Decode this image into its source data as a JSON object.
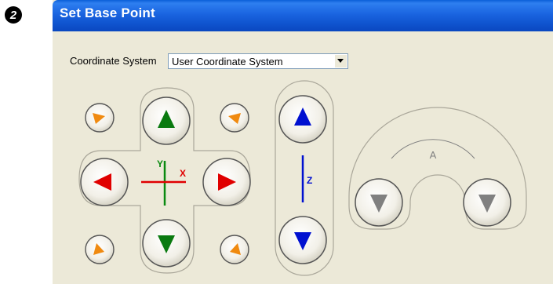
{
  "step_number": "2",
  "dialog": {
    "title": "Set Base Point",
    "coordinate_system": {
      "label": "Coordinate System",
      "selected": "User Coordinate System"
    }
  },
  "jog_pad": {
    "axis_x": "X",
    "axis_y": "Y",
    "axis_z": "Z",
    "axis_a": "A"
  },
  "colors": {
    "title_bar": "#0a5fd8",
    "window_bg": "#ece9d8",
    "x_axis": "#e00000",
    "y_axis": "#0a8a10",
    "z_axis": "#0010d0",
    "diagonal": "#f08a10",
    "a_axis": "#808080"
  }
}
